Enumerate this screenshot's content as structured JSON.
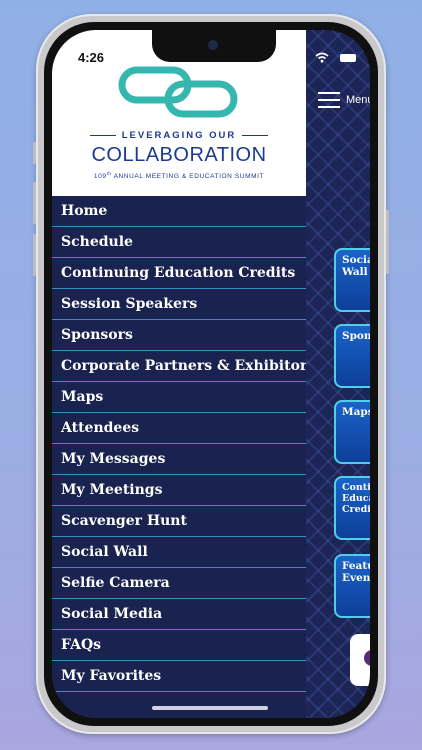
{
  "status_bar": {
    "time": "4:26"
  },
  "header": {
    "menu_label": "Menu",
    "logo_tagline": "LEVERAGING OUR",
    "logo_title": "COLLABORATION",
    "logo_ordinal": "109",
    "logo_ordinal_suffix": "th",
    "logo_subtitle": " ANNUAL MEETING & EDUCATION SUMMIT"
  },
  "menu": {
    "items": [
      {
        "label": "Home"
      },
      {
        "label": "Schedule"
      },
      {
        "label": "Continuing Education Credits"
      },
      {
        "label": "Session Speakers"
      },
      {
        "label": "Sponsors"
      },
      {
        "label": "Corporate Partners & Exhibitors"
      },
      {
        "label": "Maps"
      },
      {
        "label": "Attendees"
      },
      {
        "label": "My Messages"
      },
      {
        "label": "My Meetings"
      },
      {
        "label": "Scavenger Hunt"
      },
      {
        "label": "Social Wall"
      },
      {
        "label": "Selfie Camera"
      },
      {
        "label": "Social Media"
      },
      {
        "label": "FAQs"
      },
      {
        "label": "My Favorites"
      }
    ]
  },
  "tiles": [
    {
      "label": "Social\nWall"
    },
    {
      "label": "Sponsors"
    },
    {
      "label": "Maps"
    },
    {
      "label": "Continuing\nEducation\nCredits"
    },
    {
      "label": "Featured\nEvents"
    }
  ],
  "colors": {
    "drawer_bg": "#1a2350",
    "divider": "#3c8fc4",
    "logo_blue": "#1d3a8f",
    "logo_teal": "#35b7b0",
    "tile_border": "#4fd0e8"
  },
  "icons": {
    "menu": "hamburger-icon",
    "logo": "chain-links-icon",
    "wifi": "wifi-icon",
    "battery": "battery-icon"
  }
}
